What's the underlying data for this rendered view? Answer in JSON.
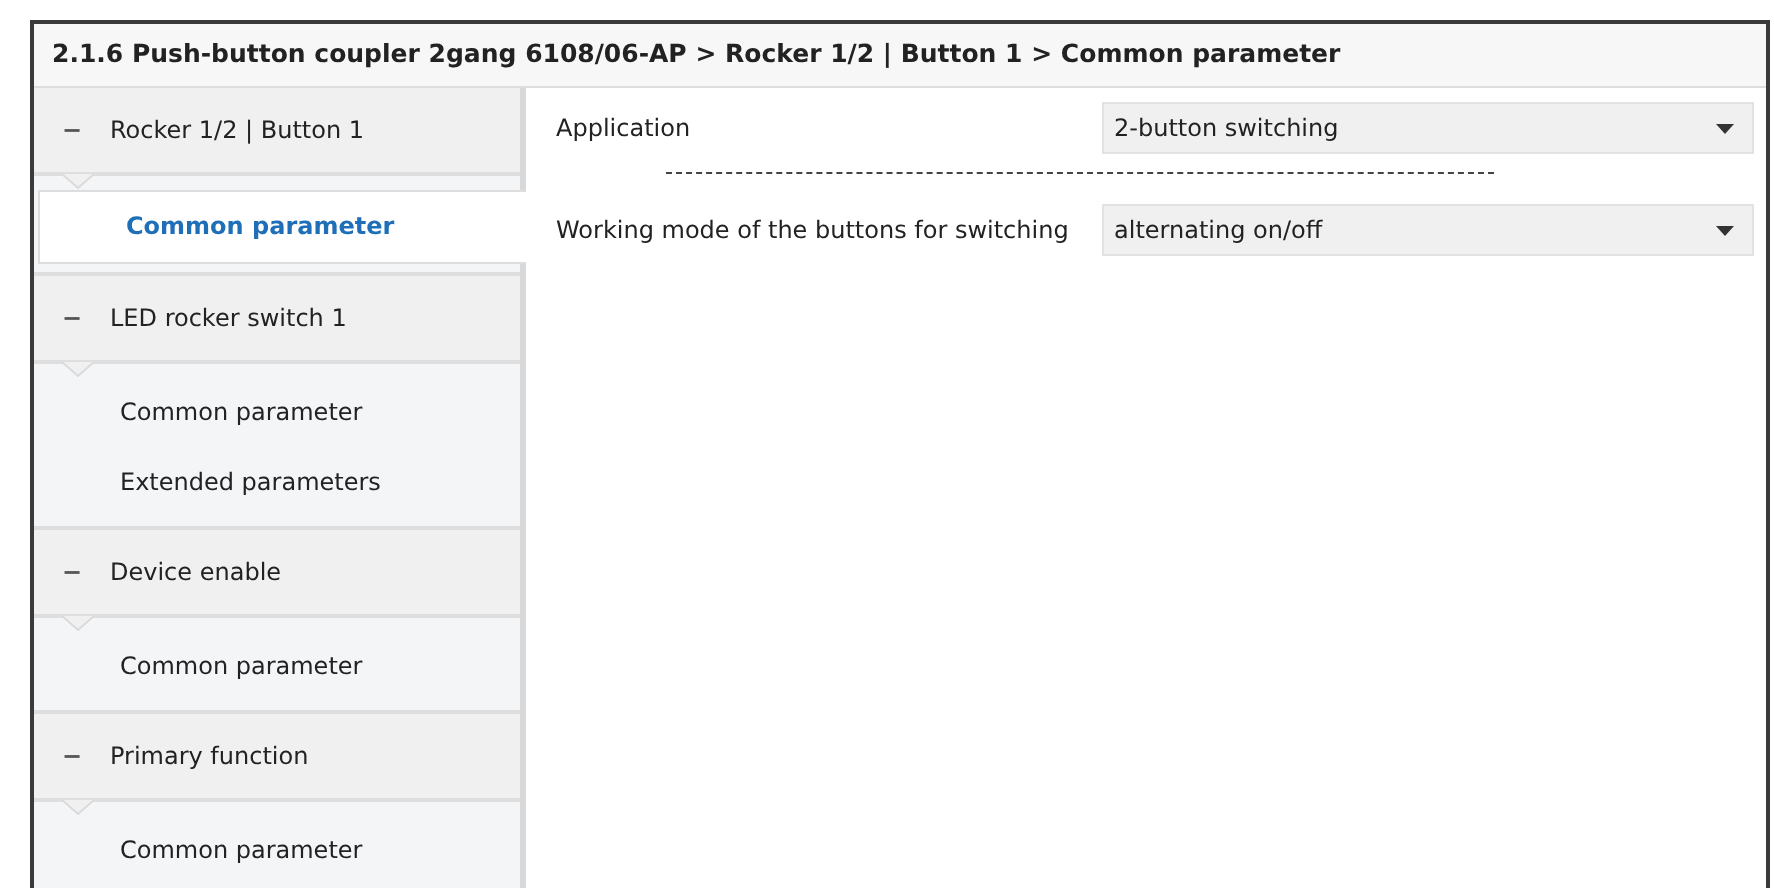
{
  "window": {
    "title": "2.1.6 Push-button coupler 2gang 6108/06-AP > Rocker 1/2 | Button 1 > Common parameter"
  },
  "sidebar": {
    "groups": [
      {
        "label": "Rocker 1/2 | Button 1",
        "toggle": "−",
        "expanded": true,
        "children": [
          {
            "label": "Common parameter",
            "selected": true
          }
        ]
      },
      {
        "label": "LED rocker switch 1",
        "toggle": "−",
        "expanded": true,
        "children": [
          {
            "label": "Common parameter",
            "selected": false
          },
          {
            "label": "Extended parameters",
            "selected": false
          }
        ]
      },
      {
        "label": "Device enable",
        "toggle": "−",
        "expanded": true,
        "children": [
          {
            "label": "Common parameter",
            "selected": false
          }
        ]
      },
      {
        "label": "Primary function",
        "toggle": "−",
        "expanded": true,
        "children": [
          {
            "label": "Common parameter",
            "selected": false
          }
        ]
      }
    ]
  },
  "parameters": [
    {
      "kind": "dropdown",
      "label": "Application",
      "value": "2-button switching"
    },
    {
      "kind": "separator"
    },
    {
      "kind": "dropdown",
      "label": "Working mode of the buttons for switching",
      "value": "alternating on/off"
    }
  ]
}
